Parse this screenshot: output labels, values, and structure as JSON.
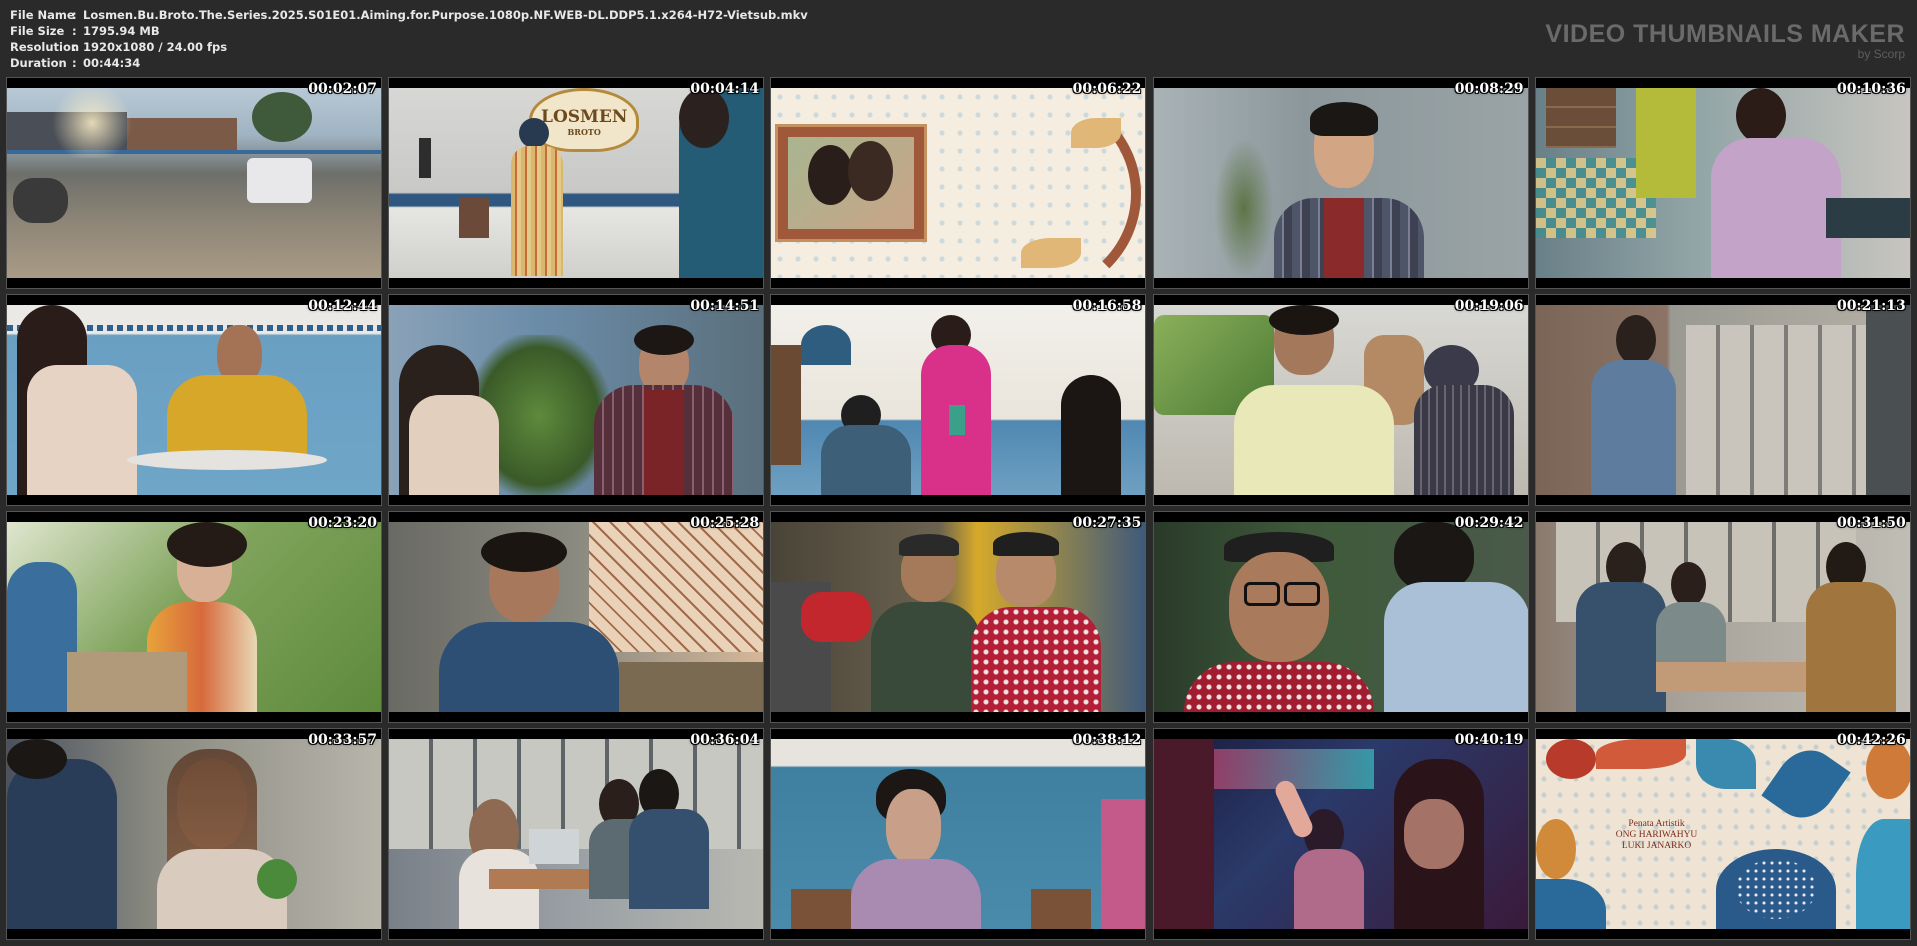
{
  "file_info": {
    "rows": [
      {
        "label": "File Name",
        "value": "Losmen.Bu.Broto.The.Series.2025.S01E01.Aiming.for.Purpose.1080p.NF.WEB-DL.DDP5.1.x264-H72-Vietsub.mkv"
      },
      {
        "label": "File Size",
        "value": "1795.94 MB"
      },
      {
        "label": "Resolution",
        "value": "1920x1080 / 24.00 fps"
      },
      {
        "label": "Duration",
        "value": "00:44:34"
      }
    ],
    "separator": ":"
  },
  "brand": {
    "title": "VIDEO THUMBNAILS MAKER",
    "subtitle": "by Scorp"
  },
  "thumbnails": [
    {
      "time": "00:02:07",
      "scene": "street-scene"
    },
    {
      "time": "00:04:14",
      "scene": "losmen-lobby"
    },
    {
      "time": "00:06:22",
      "scene": "batik-photo-frame"
    },
    {
      "time": "00:08:29",
      "scene": "young-man-smiling"
    },
    {
      "time": "00:10:36",
      "scene": "kitchen"
    },
    {
      "time": "00:12:44",
      "scene": "dining-talk"
    },
    {
      "time": "00:14:51",
      "scene": "garden-talk"
    },
    {
      "time": "00:16:58",
      "scene": "kebaya-woman"
    },
    {
      "time": "00:19:06",
      "scene": "car-interior"
    },
    {
      "time": "00:21:13",
      "scene": "corridor"
    },
    {
      "time": "00:23:20",
      "scene": "woman-in-garden"
    },
    {
      "time": "00:25:28",
      "scene": "man-by-window"
    },
    {
      "time": "00:27:35",
      "scene": "two-old-men"
    },
    {
      "time": "00:29:42",
      "scene": "old-man-glasses"
    },
    {
      "time": "00:31:50",
      "scene": "office-desk"
    },
    {
      "time": "00:33:57",
      "scene": "woman-with-phone"
    },
    {
      "time": "00:36:04",
      "scene": "cafe-laptop"
    },
    {
      "time": "00:38:12",
      "scene": "woman-blue-wall"
    },
    {
      "time": "00:40:19",
      "scene": "night-club"
    },
    {
      "time": "00:42:26",
      "scene": "batik-credits"
    }
  ],
  "credits": {
    "role": "Penata Artistik",
    "names": [
      "ONG HARIWAHYU",
      "LUKI JANARKO"
    ]
  },
  "sign_text": {
    "losmen": "LOSMEN",
    "broto": "BROTO"
  },
  "colors": {
    "background": "#2a2a2a",
    "text": "#e8e8e8",
    "brand": "#6a6a6a"
  }
}
